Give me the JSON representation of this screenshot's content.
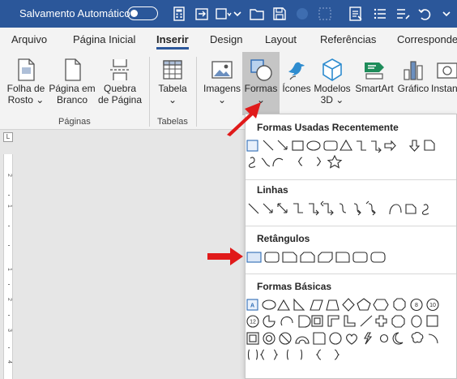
{
  "titlebar": {
    "autosave_label": "Salvamento Automático",
    "autosave_state": "off",
    "quick_icons": [
      "calculator-icon",
      "sync-icon",
      "dropdown-icon",
      "folder-icon",
      "save-icon",
      "circle-icon",
      "dots-icon",
      "form-icon",
      "list-icon",
      "undo-icon"
    ]
  },
  "tabs": [
    "Arquivo",
    "Página Inicial",
    "Inserir",
    "Design",
    "Layout",
    "Referências",
    "Corresponde"
  ],
  "active_tab": "Inserir",
  "ribbon": {
    "paginas": {
      "label": "Páginas",
      "buttons": [
        {
          "line1": "Folha de",
          "line2": "Rosto ⌄"
        },
        {
          "line1": "Página em",
          "line2": "Branco"
        },
        {
          "line1": "Quebra",
          "line2": "de Página"
        }
      ]
    },
    "tabelas": {
      "label": "Tabelas",
      "buttons": [
        {
          "line1": "Tabela",
          "line2": "⌄"
        }
      ]
    },
    "ilustracoes": {
      "buttons": [
        {
          "line1": "Imagens",
          "line2": "⌄"
        },
        {
          "line1": "Formas",
          "line2": "⌄"
        },
        {
          "line1": "Ícones",
          "line2": ""
        },
        {
          "line1": "Modelos",
          "line2": "3D ⌄"
        },
        {
          "line1": "SmartArt",
          "line2": ""
        },
        {
          "line1": "Gráfico",
          "line2": ""
        },
        {
          "line1": "Instan",
          "line2": ""
        }
      ]
    }
  },
  "ruler": {
    "corner": "L",
    "numbers": [
      "2",
      "1",
      "1",
      "2",
      "3",
      "4"
    ]
  },
  "shapes_menu": {
    "sections": [
      {
        "title": "Formas Usadas Recentemente"
      },
      {
        "title": "Linhas"
      },
      {
        "title": "Retângulos"
      },
      {
        "title": "Formas Básicas"
      }
    ],
    "grid_labels": {
      "text_box": "A",
      "num_10": "10",
      "num_12": "12",
      "num_8": "8"
    }
  },
  "colors": {
    "title_blue": "#2b579a",
    "arrow_red": "#e01a1a",
    "selected_gray": "#c5c5c5",
    "accent_green": "#1e8c5a"
  }
}
